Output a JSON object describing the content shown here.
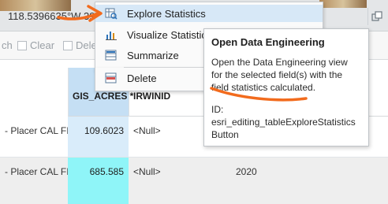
{
  "map": {
    "coordinates": "118.5396635°W 39.2..."
  },
  "toolbar": {
    "search_partial": "ch",
    "clear_label": "Clear",
    "delete_partial": "Delet"
  },
  "table": {
    "headers": {
      "gis_acres": "GIS_ACRES *",
      "irwinid": "IRWINID"
    },
    "rows": [
      {
        "name": "- Placer CAL FIRE",
        "gis_acres": "109.6023",
        "irwinid": "<Null>",
        "year": ""
      },
      {
        "name": "- Placer CAL FIRE",
        "gis_acres": "685.585",
        "irwinid": "<Null>",
        "year": "2020"
      }
    ]
  },
  "menu": {
    "items": [
      {
        "label": "Explore Statistics",
        "icon": "explore-statistics-icon"
      },
      {
        "label": "Visualize Statistics",
        "icon": "bar-chart-icon"
      },
      {
        "label": "Summarize",
        "icon": "summarize-table-icon"
      },
      {
        "label": "Delete",
        "icon": "delete-table-icon"
      }
    ]
  },
  "tooltip": {
    "title": "Open Data Engineering",
    "body": "Open the Data Engineering view for the selected field(s) with the field statistics calculated.",
    "id_label": "ID:",
    "id_value": "esri_editing_tableExploreStatisticsButton"
  },
  "colors": {
    "menu_highlight": "#d7e8f7",
    "annotation": "#f26b1d",
    "selected_cell": "#8ff5f8",
    "column_highlight": "#c5dff4"
  }
}
